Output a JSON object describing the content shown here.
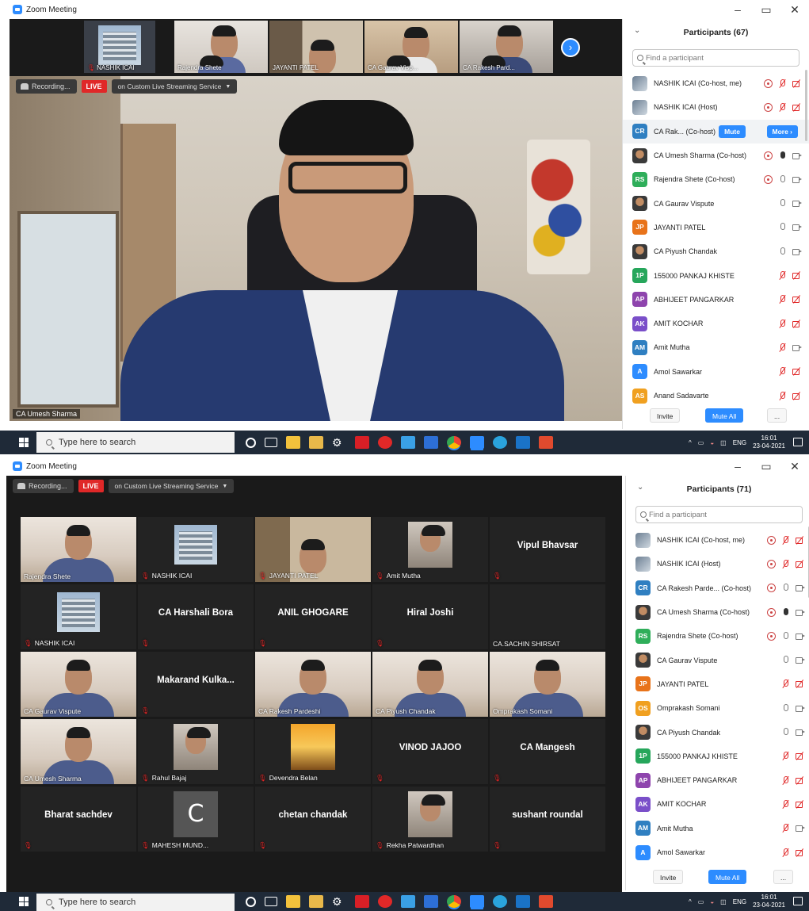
{
  "app": {
    "title": "Zoom Meeting",
    "window_controls": {
      "minimize": "–",
      "maximize": "▭",
      "close": "✕"
    }
  },
  "shot1": {
    "recording_label": "Recording...",
    "live_label": "LIVE",
    "stream_label": "on Custom Live Streaming Service",
    "thumbnails": [
      {
        "name": "NASHIK ICAI",
        "muted": true
      },
      {
        "name": "Rajendra Shete",
        "muted": false
      },
      {
        "name": "JAYANTI PATEL",
        "muted": false
      },
      {
        "name": "CA Gaurav Visp...",
        "muted": false
      },
      {
        "name": "CA Rakesh Pard...",
        "muted": false
      }
    ],
    "active_speaker": "CA Umesh Sharma",
    "participants": {
      "title": "Participants (67)",
      "search_placeholder": "Find a participant",
      "rows": [
        {
          "initials": "",
          "avatar": "image",
          "color": "#6c7f93",
          "name": "NASHIK ICAI (Co-host, me)",
          "icons": [
            "share",
            "mic-off",
            "cam-off"
          ]
        },
        {
          "initials": "",
          "avatar": "image",
          "color": "#6c7f93",
          "name": "NASHIK ICAI (Host)",
          "icons": [
            "share",
            "mic-off",
            "cam-off"
          ]
        },
        {
          "initials": "CR",
          "avatar": "initials",
          "color": "#2f7fc1",
          "name": "CA Rak... (Co-host)",
          "icons": [],
          "hover": true
        },
        {
          "initials": "",
          "avatar": "face",
          "color": "#c18c63",
          "name": "CA Umesh Sharma (Co-host)",
          "icons": [
            "share",
            "mic-live",
            "cam"
          ]
        },
        {
          "initials": "RS",
          "avatar": "initials",
          "color": "#2fae5a",
          "name": "Rajendra Shete (Co-host)",
          "icons": [
            "share",
            "mic",
            "cam"
          ]
        },
        {
          "initials": "",
          "avatar": "face",
          "color": "#8a7b6a",
          "name": "CA Gaurav Vispute",
          "icons": [
            "mic",
            "cam"
          ]
        },
        {
          "initials": "JP",
          "avatar": "initials",
          "color": "#e8731a",
          "name": "JAYANTI PATEL",
          "icons": [
            "mic",
            "cam"
          ]
        },
        {
          "initials": "",
          "avatar": "face",
          "color": "#a77",
          "name": "CA Piyush Chandak",
          "icons": [
            "mic",
            "cam"
          ]
        },
        {
          "initials": "1P",
          "avatar": "initials",
          "color": "#26a65b",
          "name": "155000 PANKAJ KHISTE",
          "icons": [
            "mic-off",
            "cam-off"
          ]
        },
        {
          "initials": "AP",
          "avatar": "initials",
          "color": "#8e44ad",
          "name": "ABHIJEET PANGARKAR",
          "icons": [
            "mic-off",
            "cam-off"
          ]
        },
        {
          "initials": "AK",
          "avatar": "initials",
          "color": "#7a4fc9",
          "name": "AMIT KOCHAR",
          "icons": [
            "mic-off",
            "cam-off"
          ]
        },
        {
          "initials": "AM",
          "avatar": "initials",
          "color": "#2f7fc1",
          "name": "Amit Mutha",
          "icons": [
            "mic-off",
            "cam"
          ]
        },
        {
          "initials": "A",
          "avatar": "initials",
          "color": "#2d8cff",
          "name": "Amol Sawarkar",
          "icons": [
            "mic-off",
            "cam-off"
          ]
        },
        {
          "initials": "AS",
          "avatar": "initials",
          "color": "#f0a020",
          "name": "Anand Sadavarte",
          "icons": [
            "mic-off",
            "cam-off"
          ]
        }
      ],
      "mute_label": "Mute",
      "more_label": "More ›",
      "invite_label": "Invite",
      "mute_all_label": "Mute All",
      "more_dots": "..."
    }
  },
  "shot2": {
    "recording_label": "Recording...",
    "live_label": "LIVE",
    "stream_label": "on Custom Live Streaming Service",
    "gallery": [
      {
        "name": "Rajendra Shete",
        "big": "",
        "type": "face",
        "muted": false
      },
      {
        "name": "NASHIK ICAI",
        "big": "",
        "type": "building",
        "muted": true
      },
      {
        "name": "JAYANTI PATEL",
        "big": "",
        "type": "shelf",
        "muted": true
      },
      {
        "name": "Amit Mutha",
        "big": "",
        "type": "face-small",
        "muted": true
      },
      {
        "name": "",
        "big": "Vipul Bhavsar",
        "type": "text",
        "muted": true
      },
      {
        "name": "NASHIK ICAI",
        "big": "",
        "type": "building",
        "muted": true
      },
      {
        "name": "",
        "big": "CA Harshali Bora",
        "type": "text",
        "muted": true
      },
      {
        "name": "",
        "big": "ANIL GHOGARE",
        "type": "text",
        "muted": true
      },
      {
        "name": "",
        "big": "Hiral Joshi",
        "type": "text",
        "muted": true
      },
      {
        "name": "CA.SACHIN SHIRSAT",
        "big": "",
        "type": "text",
        "muted": false
      },
      {
        "name": "CA Gaurav Vispute",
        "big": "",
        "type": "face",
        "muted": false
      },
      {
        "name": "",
        "big": "Makarand  Kulka...",
        "type": "text",
        "muted": true
      },
      {
        "name": "CA Rakesh Pardeshi",
        "big": "",
        "type": "face",
        "muted": false
      },
      {
        "name": "CA Piyush Chandak",
        "big": "",
        "type": "face",
        "muted": false
      },
      {
        "name": "Omprakash Somani",
        "big": "",
        "type": "face",
        "muted": false
      },
      {
        "name": "CA Umesh Sharma",
        "big": "",
        "type": "face-active",
        "muted": false
      },
      {
        "name": "Rahul Bajaj",
        "big": "",
        "type": "face-small",
        "muted": true
      },
      {
        "name": "Devendra Belan",
        "big": "",
        "type": "temple",
        "muted": true
      },
      {
        "name": "",
        "big": "VINOD JAJOO",
        "type": "text",
        "muted": true
      },
      {
        "name": "",
        "big": "CA Mangesh",
        "type": "text",
        "muted": true
      },
      {
        "name": "",
        "big": "Bharat sachdev",
        "type": "text",
        "muted": true
      },
      {
        "name": "MAHESH MUND...",
        "big": "C",
        "type": "letter",
        "muted": true
      },
      {
        "name": "",
        "big": "chetan chandak",
        "type": "text",
        "muted": true
      },
      {
        "name": "Rekha Patwardhan",
        "big": "",
        "type": "face-small",
        "muted": true
      },
      {
        "name": "",
        "big": "sushant roundal",
        "type": "text",
        "muted": true
      }
    ],
    "participants": {
      "title": "Participants (71)",
      "search_placeholder": "Find a participant",
      "rows": [
        {
          "initials": "",
          "avatar": "image",
          "color": "#6c7f93",
          "name": "NASHIK ICAI (Co-host, me)",
          "icons": [
            "share",
            "mic-off",
            "cam-off"
          ]
        },
        {
          "initials": "",
          "avatar": "image",
          "color": "#6c7f93",
          "name": "NASHIK ICAI (Host)",
          "icons": [
            "share",
            "mic-off",
            "cam-off"
          ]
        },
        {
          "initials": "CR",
          "avatar": "initials",
          "color": "#2f7fc1",
          "name": "CA Rakesh Parde... (Co-host)",
          "icons": [
            "share",
            "mic",
            "cam"
          ]
        },
        {
          "initials": "",
          "avatar": "face",
          "color": "#c18c63",
          "name": "CA Umesh Sharma (Co-host)",
          "icons": [
            "share",
            "mic-live",
            "cam"
          ]
        },
        {
          "initials": "RS",
          "avatar": "initials",
          "color": "#2fae5a",
          "name": "Rajendra Shete (Co-host)",
          "icons": [
            "share",
            "mic",
            "cam"
          ]
        },
        {
          "initials": "",
          "avatar": "face",
          "color": "#8a7b6a",
          "name": "CA Gaurav Vispute",
          "icons": [
            "mic",
            "cam"
          ]
        },
        {
          "initials": "JP",
          "avatar": "initials",
          "color": "#e8731a",
          "name": "JAYANTI PATEL",
          "icons": [
            "mic-off",
            "cam-off"
          ]
        },
        {
          "initials": "OS",
          "avatar": "initials",
          "color": "#f0a020",
          "name": "Omprakash Somani",
          "icons": [
            "mic",
            "cam"
          ]
        },
        {
          "initials": "",
          "avatar": "face",
          "color": "#a77",
          "name": "CA Piyush Chandak",
          "icons": [
            "mic",
            "cam"
          ]
        },
        {
          "initials": "1P",
          "avatar": "initials",
          "color": "#26a65b",
          "name": "155000 PANKAJ KHISTE",
          "icons": [
            "mic-off",
            "cam-off"
          ]
        },
        {
          "initials": "AP",
          "avatar": "initials",
          "color": "#8e44ad",
          "name": "ABHIJEET PANGARKAR",
          "icons": [
            "mic-off",
            "cam-off"
          ]
        },
        {
          "initials": "AK",
          "avatar": "initials",
          "color": "#7a4fc9",
          "name": "AMIT KOCHAR",
          "icons": [
            "mic-off",
            "cam-off"
          ]
        },
        {
          "initials": "AM",
          "avatar": "initials",
          "color": "#2f7fc1",
          "name": "Amit Mutha",
          "icons": [
            "mic-off",
            "cam"
          ]
        },
        {
          "initials": "A",
          "avatar": "initials",
          "color": "#2d8cff",
          "name": "Amol Sawarkar",
          "icons": [
            "mic-off",
            "cam-off"
          ]
        }
      ],
      "invite_label": "Invite",
      "mute_all_label": "Mute All",
      "more_dots": "..."
    }
  },
  "taskbar": {
    "search_placeholder": "Type here to search",
    "apps": [
      "cortana",
      "task-view",
      "store",
      "file-explorer",
      "settings",
      "netflix",
      "acrobat",
      "photos",
      "media",
      "chrome",
      "zoom",
      "telegram",
      "outlook",
      "pdf"
    ],
    "language": "ENG",
    "time": "16:01",
    "date": "23-04-2021"
  },
  "colors": {
    "zoom_blue": "#2d8cff",
    "live_red": "#e02828",
    "meeting_bg": "#1a1a1a",
    "taskbar_bg": "#1f2a38"
  }
}
